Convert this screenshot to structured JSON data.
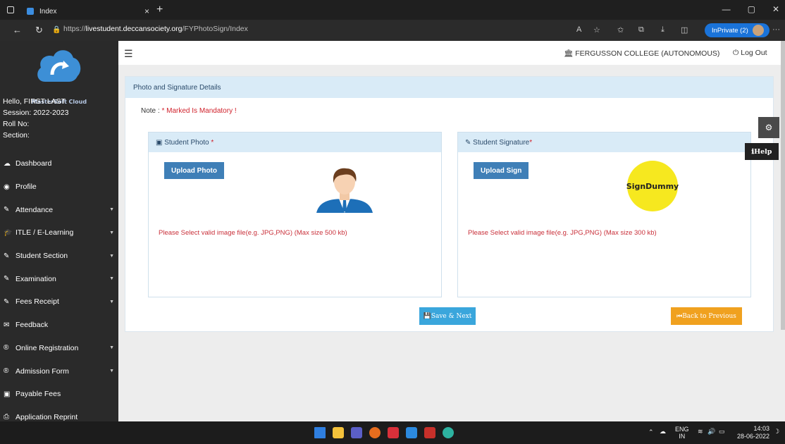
{
  "browser": {
    "tab_title": "Index",
    "tab_close": "×",
    "new_tab": "+",
    "url_prefix": "https://",
    "url_host": "livestudent.deccansociety.org",
    "url_path": "/FYPhotoSign/Index",
    "inprivate_label": "InPrivate (2)",
    "more_label": "···"
  },
  "sidebar": {
    "logo_text": "MasterSoft Cloud",
    "greeting": "Hello, FIRST LAST",
    "session": "Session: 2022-2023",
    "roll_no": "Roll No:",
    "section": "Section:",
    "items": [
      {
        "icon": "☁",
        "label": "Dashboard",
        "caret": false
      },
      {
        "icon": "◉",
        "label": "Profile",
        "caret": false
      },
      {
        "icon": "✎",
        "label": "Attendance",
        "caret": true
      },
      {
        "icon": "🎓",
        "label": "ITLE / E-Learning",
        "caret": true
      },
      {
        "icon": "✎",
        "label": "Student Section",
        "caret": true
      },
      {
        "icon": "✎",
        "label": "Examination",
        "caret": true
      },
      {
        "icon": "✎",
        "label": "Fees Receipt",
        "caret": true
      },
      {
        "icon": "✉",
        "label": "Feedback",
        "caret": false
      },
      {
        "icon": "®",
        "label": "Online Registration",
        "caret": true
      },
      {
        "icon": "®",
        "label": "Admission Form",
        "caret": true
      },
      {
        "icon": "▣",
        "label": "Payable Fees",
        "caret": false
      },
      {
        "icon": "⎙",
        "label": "Application Reprint",
        "caret": false
      }
    ]
  },
  "header": {
    "college": "FERGUSSON COLLEGE (AUTONOMOUS)",
    "logout": "Log Out"
  },
  "panel": {
    "title": "Photo and Signature Details",
    "note_label": "Note :",
    "note_text": "* Marked Is Mandatory !",
    "photo_box": {
      "title": "Student Photo",
      "star": " *",
      "button": "Upload Photo",
      "hint": "Please Select valid image file(e.g. JPG,PNG) (Max size 500 kb)"
    },
    "sign_box": {
      "title": "Student Signature",
      "star": "*",
      "button": "Upload Sign",
      "sign_text": "SignDummy",
      "hint": "Please Select valid image file(e.g. JPG,PNG) (Max size 300 kb)"
    },
    "save_label": "Save & Next",
    "back_label": "Back to Previous"
  },
  "floating": {
    "help_label": "Help"
  },
  "taskbar": {
    "lang": "ENG",
    "region": "IN",
    "time": "14:03",
    "date": "28-06-2022"
  }
}
